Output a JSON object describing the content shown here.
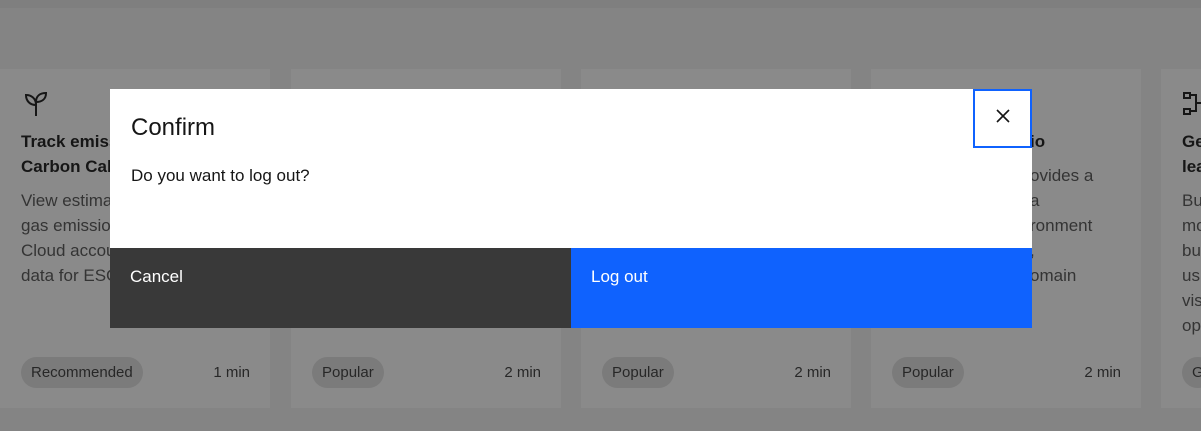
{
  "background": {
    "cards": [
      {
        "icon": "sprout-icon",
        "title": "Track emissions with\nCarbon Calculator",
        "description": "View estimated greenhouse\ngas emissions from your IBM\nCloud account and use that\ndata for ESG reporting.",
        "tag": "Recommended",
        "duration": "1 min"
      },
      {
        "icon": "",
        "title": "",
        "description": "",
        "tag": "Popular",
        "duration": "2 min"
      },
      {
        "icon": "",
        "title": "",
        "description": "",
        "tag": "Popular",
        "duration": "2 min"
      },
      {
        "icon": "",
        "title": "io",
        "description": "ovides a\na\nronment\n,\nomain",
        "tag": "Popular",
        "duration": "2 min"
      },
      {
        "icon": "flow-icon",
        "title": "Ge\nlea",
        "description": "Bu\nmo\nbu\nus\nvis\nop",
        "tag": "G",
        "duration": ""
      }
    ]
  },
  "modal": {
    "title": "Confirm",
    "body": "Do you want to log out?",
    "close_icon": "close-icon",
    "cancel_label": "Cancel",
    "confirm_label": "Log out"
  },
  "colors": {
    "primary": "#0f62fe",
    "secondary": "#393939",
    "overlay": "rgba(22,22,22,0.5)"
  }
}
